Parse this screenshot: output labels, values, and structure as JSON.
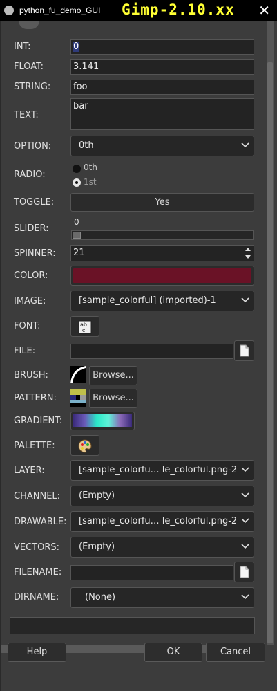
{
  "window": {
    "title": "python_fu_demo_GUI",
    "watermark": "Gimp-2.10.xx",
    "close": "✕"
  },
  "fields": {
    "int": {
      "label": "INT:",
      "value": "0"
    },
    "float": {
      "label": "FLOAT:",
      "value": "3.141"
    },
    "string": {
      "label": "STRING:",
      "value": "foo"
    },
    "text": {
      "label": "TEXT:",
      "value": "bar"
    },
    "option": {
      "label": "OPTION:",
      "value": "0th"
    },
    "radio": {
      "label": "RADIO:",
      "options": [
        "0th",
        "1st"
      ],
      "selected": "1st"
    },
    "toggle": {
      "label": "TOGGLE:",
      "value": "Yes"
    },
    "slider": {
      "label": "SLIDER:",
      "value": "0"
    },
    "spinner": {
      "label": "SPINNER:",
      "value": "21"
    },
    "color": {
      "label": "COLOR:",
      "value": "#6a1226"
    },
    "image": {
      "label": "IMAGE:",
      "value": "[sample_colorful] (imported)-1"
    },
    "font": {
      "label": "FONT:"
    },
    "file": {
      "label": "FILE:",
      "value": ""
    },
    "brush": {
      "label": "BRUSH:",
      "button": "Browse..."
    },
    "pattern": {
      "label": "PATTERN:",
      "button": "Browse..."
    },
    "gradient": {
      "label": "GRADIENT:"
    },
    "palette": {
      "label": "PALETTE:"
    },
    "layer": {
      "label": "LAYER:",
      "value": "[sample_colorfu… le_colorful.png-2"
    },
    "channel": {
      "label": "CHANNEL:",
      "value": "(Empty)"
    },
    "drawable": {
      "label": "DRAWABLE:",
      "value": "[sample_colorfu… le_colorful.png-2"
    },
    "vectors": {
      "label": "VECTORS:",
      "value": "(Empty)"
    },
    "filename": {
      "label": "FILENAME:",
      "value": ""
    },
    "dirname": {
      "label": "DIRNAME:",
      "value": "(None)"
    }
  },
  "buttons": {
    "help": "Help",
    "ok": "OK",
    "cancel": "Cancel"
  },
  "icons": {
    "file_chooser": "document-icon",
    "font": "font-icon",
    "palette": "palette-icon",
    "combo": "chevron-down-icon"
  }
}
